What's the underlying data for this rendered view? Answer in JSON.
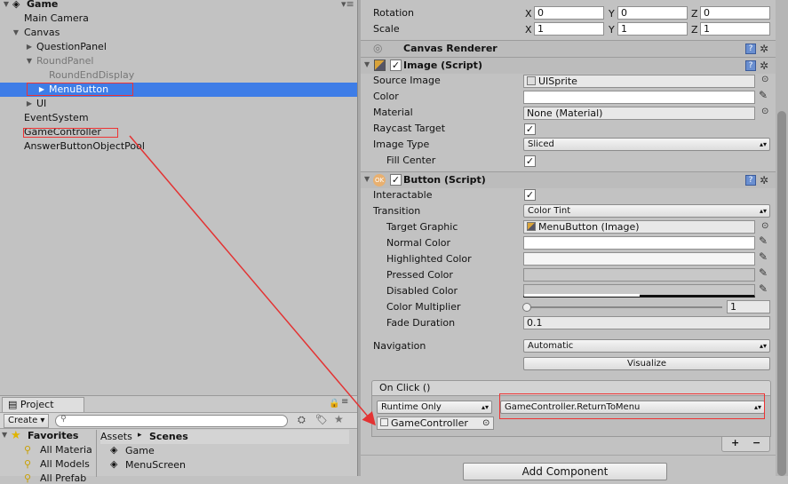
{
  "hierarchy": {
    "scene_name": "Game",
    "items": [
      {
        "label": "Main Camera"
      },
      {
        "label": "Canvas"
      },
      {
        "label": "QuestionPanel"
      },
      {
        "label": "RoundPanel"
      },
      {
        "label": "RoundEndDisplay"
      },
      {
        "label": "MenuButton"
      },
      {
        "label": "UI"
      },
      {
        "label": "EventSystem"
      },
      {
        "label": "GameController"
      },
      {
        "label": "AnswerButtonObjectPool"
      }
    ]
  },
  "inspector": {
    "transform": {
      "rotation_label": "Rotation",
      "scale_label": "Scale",
      "rotation": {
        "x_label": "X",
        "x": "0",
        "y_label": "Y",
        "y": "0",
        "z_label": "Z",
        "z": "0"
      },
      "scale": {
        "x_label": "X",
        "x": "1",
        "y_label": "Y",
        "y": "1",
        "z_label": "Z",
        "z": "1"
      }
    },
    "canvas_renderer": {
      "title": "Canvas Renderer"
    },
    "image": {
      "title": "Image (Script)",
      "source_image_label": "Source Image",
      "source_image_value": "UISprite",
      "color_label": "Color",
      "material_label": "Material",
      "material_value": "None (Material)",
      "raycast_label": "Raycast Target",
      "image_type_label": "Image Type",
      "image_type_value": "Sliced",
      "fill_center_label": "Fill Center"
    },
    "button": {
      "title": "Button (Script)",
      "interactable_label": "Interactable",
      "transition_label": "Transition",
      "transition_value": "Color Tint",
      "target_graphic_label": "Target Graphic",
      "target_graphic_value": "MenuButton (Image)",
      "normal_color_label": "Normal Color",
      "highlighted_color_label": "Highlighted Color",
      "pressed_color_label": "Pressed Color",
      "disabled_color_label": "Disabled Color",
      "color_multiplier_label": "Color Multiplier",
      "color_multiplier_value": "1",
      "fade_duration_label": "Fade Duration",
      "fade_duration_value": "0.1",
      "navigation_label": "Navigation",
      "navigation_value": "Automatic",
      "visualize_label": "Visualize",
      "on_click_label": "On Click ()",
      "runtime_value": "Runtime Only",
      "function_value": "GameController.ReturnToMenu",
      "object_value": "GameController",
      "plus": "+",
      "minus": "−"
    },
    "add_component_label": "Add Component"
  },
  "project": {
    "tab_label": "Project",
    "create_label": "Create",
    "favorites_label": "Favorites",
    "favorites": [
      "All Materia",
      "All Models",
      "All Prefab"
    ],
    "breadcrumb_root": "Assets",
    "breadcrumb_sep": "▸",
    "breadcrumb_current": "Scenes",
    "assets": [
      "Game",
      "MenuScreen"
    ]
  },
  "colors": {
    "selection": "#3e7de7",
    "annotation": "#e33333"
  }
}
